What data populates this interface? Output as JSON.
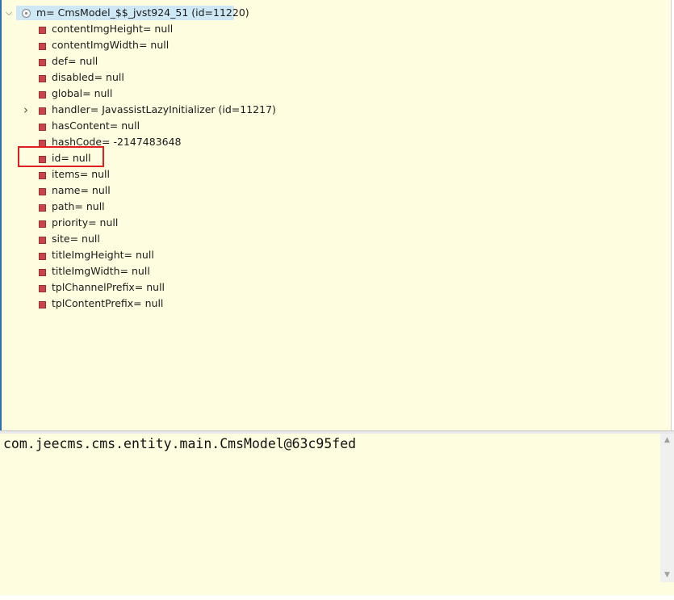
{
  "tree": {
    "root": {
      "label": "m= CmsModel_$$_jvst924_51  (id=11220)",
      "expanded": true
    },
    "children": [
      {
        "label": "contentImgHeight= null",
        "expandable": false
      },
      {
        "label": "contentImgWidth= null",
        "expandable": false
      },
      {
        "label": "def= null",
        "expandable": false
      },
      {
        "label": "disabled= null",
        "expandable": false
      },
      {
        "label": "global= null",
        "expandable": false
      },
      {
        "label": "handler= JavassistLazyInitializer  (id=11217)",
        "expandable": true
      },
      {
        "label": "hasContent= null",
        "expandable": false
      },
      {
        "label": "hashCode= -2147483648",
        "expandable": false
      },
      {
        "label": "id= null",
        "expandable": false,
        "highlighted": true
      },
      {
        "label": "items= null",
        "expandable": false
      },
      {
        "label": "name= null",
        "expandable": false
      },
      {
        "label": "path= null",
        "expandable": false
      },
      {
        "label": "priority= null",
        "expandable": false
      },
      {
        "label": "site= null",
        "expandable": false
      },
      {
        "label": "titleImgHeight= null",
        "expandable": false
      },
      {
        "label": "titleImgWidth= null",
        "expandable": false
      },
      {
        "label": "tplChannelPrefix= null",
        "expandable": false
      },
      {
        "label": "tplContentPrefix= null",
        "expandable": false
      }
    ]
  },
  "detail": {
    "value_text": "com.jeecms.cms.entity.main.CmsModel@63c95fed"
  },
  "colors": {
    "background": "#fffde0",
    "selection": "#cfe8f6",
    "field_icon": "#c8454b",
    "highlight_box": "#e02020"
  },
  "icons": {
    "expanded": "chevron-down-icon",
    "collapsed": "chevron-right-icon",
    "root": "object-icon",
    "field": "private-field-icon"
  }
}
